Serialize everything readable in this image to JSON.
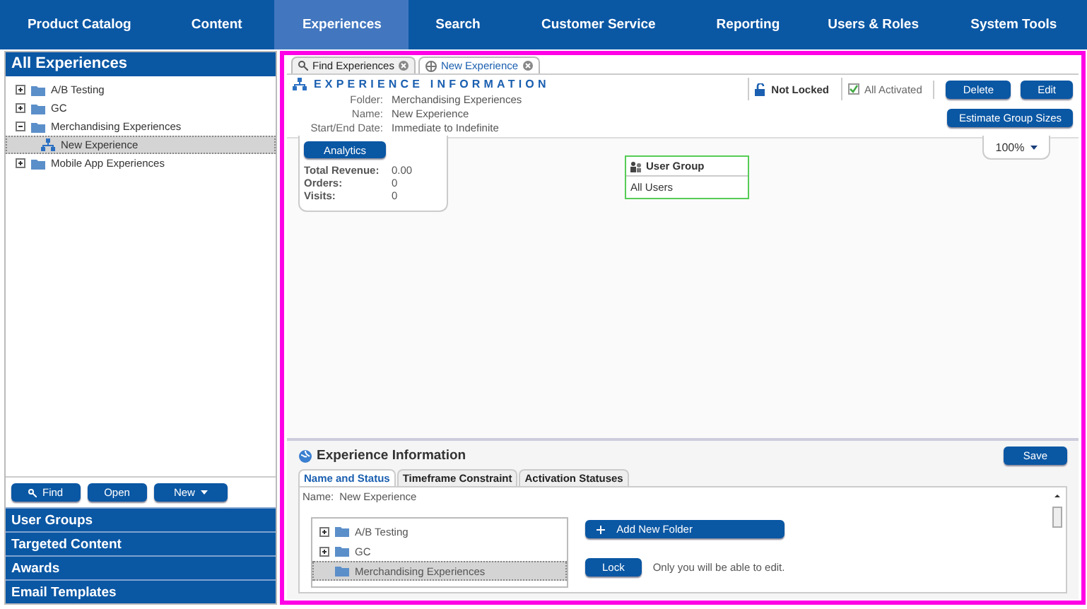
{
  "nav": [
    {
      "label": "Product Catalog",
      "selected": false
    },
    {
      "label": "Content",
      "selected": false
    },
    {
      "label": "Experiences",
      "selected": true
    },
    {
      "label": "Search",
      "selected": false
    },
    {
      "label": "Customer Service",
      "selected": false
    },
    {
      "label": "Reporting",
      "selected": false
    },
    {
      "label": "Users & Roles",
      "selected": false
    },
    {
      "label": "System Tools",
      "selected": false
    }
  ],
  "sidebar": {
    "title": "All Experiences",
    "tree": [
      {
        "label": "A/B Testing",
        "kind": "folder",
        "expanded": false,
        "selected": false
      },
      {
        "label": "GC",
        "kind": "folder",
        "expanded": false,
        "selected": false
      },
      {
        "label": "Merchandising Experiences",
        "kind": "folder",
        "expanded": true,
        "selected": false,
        "children": [
          {
            "label": "New Experience",
            "kind": "experience",
            "selected": true
          }
        ]
      },
      {
        "label": "Mobile App Experiences",
        "kind": "folder",
        "expanded": false,
        "selected": false
      }
    ],
    "buttons": [
      {
        "label": "Find",
        "kind": "find"
      },
      {
        "label": "Open",
        "kind": "plain"
      },
      {
        "label": "New",
        "kind": "menu"
      }
    ],
    "sections": [
      "User Groups",
      "Targeted Content",
      "Awards",
      "Email Templates"
    ]
  },
  "doc_tabs": [
    {
      "label": "Find Experiences",
      "kind": "search",
      "selected": false
    },
    {
      "label": "New Experience",
      "kind": "experience",
      "selected": true
    }
  ],
  "info": {
    "title": "EXPERIENCE INFORMATION",
    "fields": [
      {
        "label": "Folder:",
        "value": "Merchandising Experiences"
      },
      {
        "label": "Name:",
        "value": "New Experience"
      },
      {
        "label": "Start/End Date:",
        "value": "Immediate to Indefinite"
      }
    ],
    "lock_status": "Not Locked",
    "activation_status": "All Activated",
    "buttons": [
      "Delete",
      "Edit"
    ],
    "estimate_button": "Estimate Group Sizes"
  },
  "canvas": {
    "analytics": {
      "button": "Analytics",
      "stats": [
        {
          "label": "Total Revenue:",
          "value": "0.00"
        },
        {
          "label": "Orders:",
          "value": "0"
        },
        {
          "label": "Visits:",
          "value": "0"
        }
      ]
    },
    "zoom": "100%",
    "user_group": {
      "title": "User Group",
      "value": "All Users"
    }
  },
  "details": {
    "title": "Experience Information",
    "save": "Save",
    "tabs": [
      {
        "label": "Name and Status",
        "selected": true
      },
      {
        "label": "Timeframe Constraint",
        "selected": false
      },
      {
        "label": "Activation Statuses",
        "selected": false
      }
    ],
    "name_label": "Name:",
    "name_value": "New Experience",
    "folders": [
      {
        "label": "A/B Testing",
        "expandable": true,
        "selected": false
      },
      {
        "label": "GC",
        "expandable": true,
        "selected": false
      },
      {
        "label": "Merchandising Experiences",
        "expandable": false,
        "selected": true
      }
    ],
    "add_folder": "Add New Folder",
    "lock_button": "Lock",
    "lock_note": "Only you will be able to edit."
  }
}
